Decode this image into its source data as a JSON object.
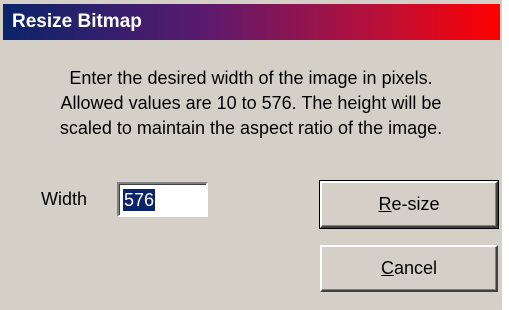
{
  "window": {
    "title": "Resize Bitmap"
  },
  "message": {
    "lines": [
      "Enter the desired width of the image in pixels.",
      "Allowed values are 10 to 576.  The height will be",
      "scaled to maintain the aspect ratio of the image."
    ]
  },
  "width_field": {
    "label": "Width",
    "value": "576"
  },
  "buttons": {
    "resize": {
      "mnemonic": "R",
      "rest": "e-size"
    },
    "cancel": {
      "mnemonic": "C",
      "rest": "ancel"
    }
  },
  "colors": {
    "title_gradient_start": "#0a246a",
    "title_gradient_end": "#ff0000",
    "dialog_face": "#d4d0c8",
    "selection": "#0a246a"
  }
}
